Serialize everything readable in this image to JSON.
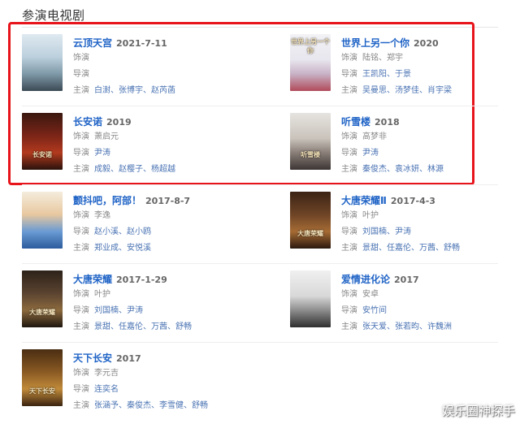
{
  "section": {
    "title": "参演电视剧"
  },
  "labels": {
    "role": "饰演",
    "director": "导演",
    "cast": "主演"
  },
  "shows": [
    {
      "title": "云顶天宫",
      "date": "2021-7-11",
      "role": "",
      "director": "",
      "cast": [
        "白澍",
        "张博宇",
        "赵芮菡"
      ],
      "poster_text": ""
    },
    {
      "title": "世界上另一个你",
      "date": "2020",
      "role": "陆铭、郑宇",
      "director": "王凯阳、于景",
      "cast": [
        "吴曼思",
        "汤梦佳",
        "肖宇梁"
      ],
      "poster_text": "世界上另一个你"
    },
    {
      "title": "长安诺",
      "date": "2019",
      "role": "萧启元",
      "director": "尹涛",
      "cast": [
        "成毅",
        "赵樱子",
        "杨超越"
      ],
      "poster_text": "长安诺"
    },
    {
      "title": "听雪楼",
      "date": "2018",
      "role": "高梦非",
      "director": "尹涛",
      "cast": [
        "秦俊杰",
        "袁冰妍",
        "林源"
      ],
      "poster_text": "听雪楼"
    },
    {
      "title": "颤抖吧，阿部！",
      "date": "2017-8-7",
      "role": "李逸",
      "director": "赵小溪、赵小鸥",
      "cast": [
        "郑业成",
        "安悦溪"
      ],
      "poster_text": ""
    },
    {
      "title": "大唐荣耀Ⅱ",
      "date": "2017-4-3",
      "role": "叶护",
      "director": "刘国楠、尹涛",
      "cast": [
        "景甜",
        "任嘉伦",
        "万茜",
        "舒畅"
      ],
      "poster_text": "大唐荣耀"
    },
    {
      "title": "大唐荣耀",
      "date": "2017-1-29",
      "role": "叶护",
      "director": "刘国楠、尹涛",
      "cast": [
        "景甜",
        "任嘉伦",
        "万茜",
        "舒畅"
      ],
      "poster_text": "大唐荣耀"
    },
    {
      "title": "爱情进化论",
      "date": "2017",
      "role": "安卓",
      "director": "安竹间",
      "cast": [
        "张天爱",
        "张若昀",
        "许魏洲"
      ],
      "poster_text": ""
    },
    {
      "title": "天下长安",
      "date": "2017",
      "role": "李元吉",
      "director": "连奕名",
      "cast": [
        "张涵予",
        "秦俊杰",
        "李雪健",
        "舒畅"
      ],
      "poster_text": "天下长安"
    }
  ],
  "colors": {
    "link": "#1f63c6",
    "highlight": "#e8141b"
  },
  "watermark": "娱乐圈神探手"
}
